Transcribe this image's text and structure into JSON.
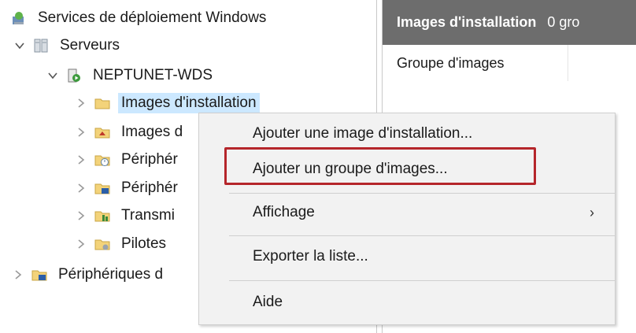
{
  "tree": {
    "root": "Services de déploiement Windows",
    "servers": "Serveurs",
    "server_name": "NEPTUNET-WDS",
    "items": [
      {
        "label": "Images d'installation"
      },
      {
        "label": "Images d"
      },
      {
        "label": "Périphér"
      },
      {
        "label": "Périphér"
      },
      {
        "label": "Transmi"
      },
      {
        "label": "Pilotes"
      }
    ],
    "last_root": "Périphériques d"
  },
  "right_pane": {
    "header_title": "Images d'installation",
    "header_count": "0 gro",
    "column_header": "Groupe d'images"
  },
  "context_menu": {
    "items": [
      {
        "label": "Ajouter une image d'installation..."
      },
      {
        "label": "Ajouter un groupe d'images..."
      },
      {
        "label": "Affichage",
        "submenu": "›"
      },
      {
        "label": "Exporter la liste..."
      },
      {
        "label": "Aide"
      }
    ]
  },
  "colors": {
    "selection": "#cce8ff",
    "header_bg": "#6d6d6d",
    "menu_bg": "#f2f2f2",
    "highlight": "#b5262b"
  }
}
